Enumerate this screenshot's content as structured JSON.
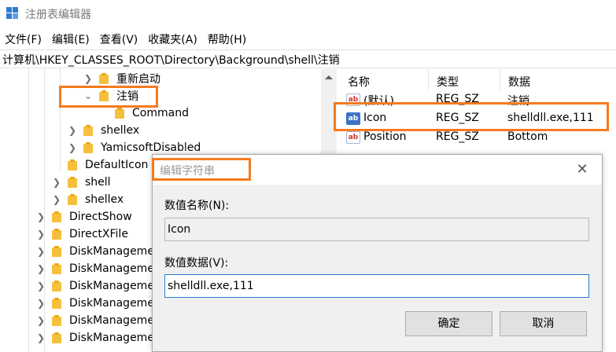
{
  "window": {
    "title": "注册表编辑器"
  },
  "menu": [
    "文件(F)",
    "编辑(E)",
    "查看(V)",
    "收藏夹(A)",
    "帮助(H)"
  ],
  "address": "计算机\\HKEY_CLASSES_ROOT\\Directory\\Background\\shell\\注销",
  "tree": [
    {
      "label": "重新启动",
      "expander": "collapsed"
    },
    {
      "label": "注销",
      "expander": "expanded"
    },
    {
      "label": "Command",
      "expander": "none"
    },
    {
      "label": "shellex",
      "expander": "collapsed"
    },
    {
      "label": "YamicsoftDisabled",
      "expander": "collapsed"
    },
    {
      "label": "DefaultIcon",
      "expander": "none"
    },
    {
      "label": "shell",
      "expander": "collapsed"
    },
    {
      "label": "shellex",
      "expander": "collapsed"
    },
    {
      "label": "DirectShow",
      "expander": "collapsed"
    },
    {
      "label": "DirectXFile",
      "expander": "collapsed"
    },
    {
      "label": "DiskManageme",
      "expander": "collapsed"
    },
    {
      "label": "DiskManageme",
      "expander": "collapsed"
    },
    {
      "label": "DiskManageme",
      "expander": "collapsed"
    },
    {
      "label": "DiskManageme",
      "expander": "collapsed"
    },
    {
      "label": "DiskManageme",
      "expander": "collapsed"
    },
    {
      "label": "DiskManageme",
      "expander": "collapsed"
    }
  ],
  "values": {
    "columns": [
      "名称",
      "类型",
      "数据"
    ],
    "rows": [
      {
        "name": "(默认)",
        "type": "REG_SZ",
        "data": "注销",
        "icon": "string-value-icon"
      },
      {
        "name": "Icon",
        "type": "REG_SZ",
        "data": "shelldll.exe,111",
        "icon": "string-value-icon"
      },
      {
        "name": "Position",
        "type": "REG_SZ",
        "data": "Bottom",
        "icon": "string-value-icon"
      }
    ]
  },
  "dialog": {
    "title": "编辑字符串",
    "name_label": "数值名称(N):",
    "name_value": "Icon",
    "data_label": "数值数据(V):",
    "data_value": "shelldll.exe,111",
    "ok_label": "确定",
    "cancel_label": "取消"
  },
  "colors": {
    "highlight": "#f57b1f",
    "folder": "#f5c03b",
    "accent": "#2b7cd3"
  }
}
